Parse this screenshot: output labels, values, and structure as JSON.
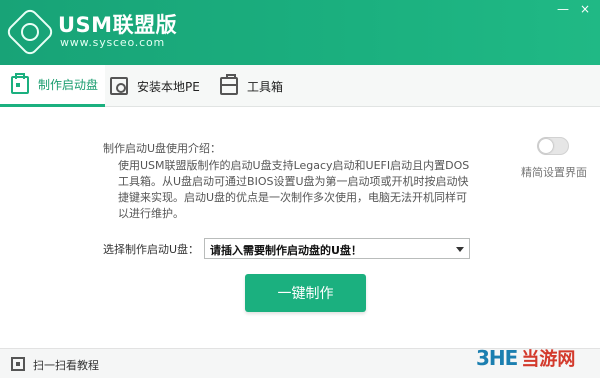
{
  "app": {
    "title": "USM联盟版",
    "site": "www.sysceo.com",
    "min_glyph": "—",
    "close_glyph": "×"
  },
  "tabs": [
    {
      "label": "制作启动盘",
      "icon": "usb-icon",
      "active": true
    },
    {
      "label": "安装本地PE",
      "icon": "folder-gear-icon",
      "active": false
    },
    {
      "label": "工具箱",
      "icon": "toolbox-icon",
      "active": false
    }
  ],
  "intro": {
    "title": "制作启动U盘使用介绍：",
    "body": "使用USM联盟版制作的启动U盘支持Legacy启动和UEFI启动且内置DOS工具箱。从U盘启动可通过BIOS设置U盘为第一启动项或开机时按启动快捷键来实现。启动U盘的优点是一次制作多次使用，电脑无法开机同样可以进行维护。"
  },
  "simple_mode": {
    "label": "精简设置界面",
    "on": false
  },
  "select_drive": {
    "label": "选择制作启动U盘：",
    "value": "请插入需要制作启动盘的U盘！"
  },
  "make_button": {
    "label": "一键制作"
  },
  "footer": {
    "scan_text": "扫一扫看教程"
  },
  "watermark": {
    "mark": "3HE",
    "text": "当游网"
  },
  "colors": {
    "accent": "#1bb07f",
    "header": "#18a377",
    "watermark_blue": "#1b7fb0",
    "watermark_red": "#d33a2c"
  }
}
